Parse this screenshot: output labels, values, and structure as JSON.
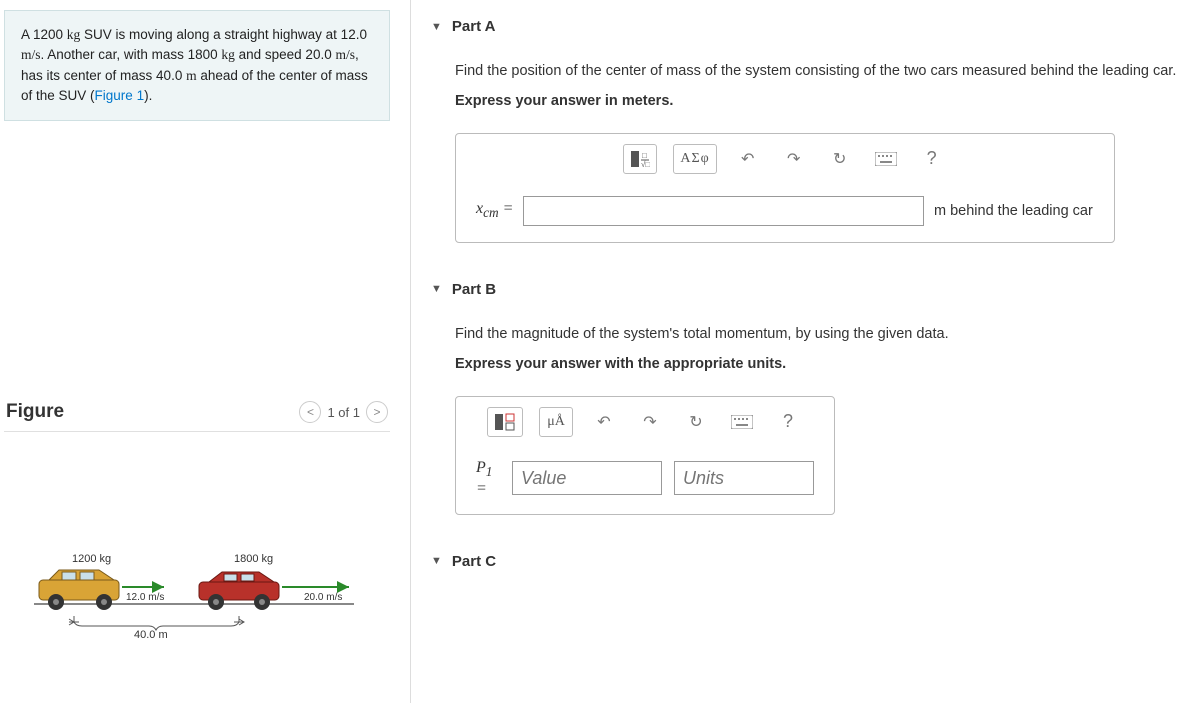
{
  "problem": {
    "text": "A 1200 kg SUV is moving along a straight highway at 12.0 m/s. Another car, with mass 1800 kg and speed 20.0 m/s, has its center of mass 40.0 m ahead of the center of mass of the SUV (Figure 1).",
    "figure_link_text": "Figure 1"
  },
  "figure_panel": {
    "title": "Figure",
    "pager": "1 of 1",
    "labels": {
      "suv_mass": "1200 kg",
      "suv_speed": "12.0 m/s",
      "car_mass": "1800 kg",
      "car_speed": "20.0 m/s",
      "distance": "40.0 m"
    }
  },
  "parts": {
    "a": {
      "title": "Part A",
      "prompt": "Find the position of the center of mass of the system consisting of the two cars measured behind the leading car.",
      "instruction": "Express your answer in meters.",
      "var_label": "x_cm =",
      "unit_label": "m behind the leading car",
      "toolbar": {
        "greek": "ΑΣφ",
        "help": "?"
      }
    },
    "b": {
      "title": "Part B",
      "prompt": "Find the magnitude of the system's total momentum, by using the given data.",
      "instruction": "Express your answer with the appropriate units.",
      "var_label": "P₁ =",
      "value_placeholder": "Value",
      "units_placeholder": "Units",
      "toolbar": {
        "units_btn": "μÅ",
        "help": "?"
      }
    },
    "c": {
      "title": "Part C"
    }
  }
}
